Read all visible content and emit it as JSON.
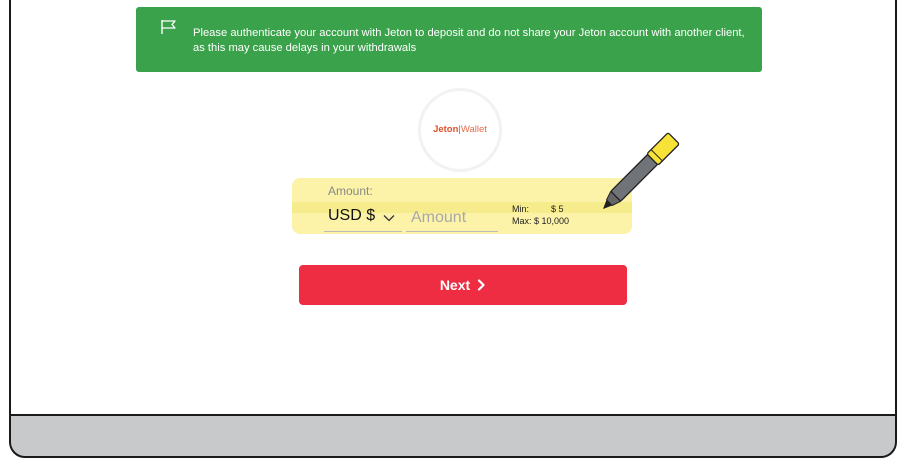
{
  "banner": {
    "message": "Please authenticate your account with Jeton to deposit and do not share your Jeton account with another client, as this may cause delays in your withdrawals",
    "icon": "flag-icon",
    "color": "#3aa24a"
  },
  "logo": {
    "brand": "Jeton",
    "separator": "|",
    "product": "Wallet",
    "color": "#e0522a"
  },
  "form": {
    "amount_label": "Amount:",
    "currency_selected": "USD $",
    "amount_placeholder": "Amount",
    "min_label": "Min:",
    "min_value": "$ 5",
    "max_text": "Max: $ 10,000",
    "highlight_color": "#fcf3a8"
  },
  "next_button": {
    "label": "Next",
    "icon": "chevron-right-icon",
    "color": "#ee2d42"
  },
  "annotation": {
    "icon": "marker-pen-icon",
    "color": "#f7e337"
  }
}
